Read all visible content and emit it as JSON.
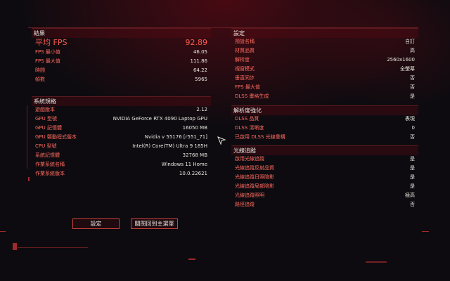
{
  "results": {
    "header": "結果",
    "avg_fps_label": "平均 FPS",
    "avg_fps_value": "92.89",
    "rows": [
      {
        "label": "FPS 最小值",
        "value": "46.05"
      },
      {
        "label": "FPS 最大值",
        "value": "111.86"
      },
      {
        "label": "時間",
        "value": "64.22"
      },
      {
        "label": "幀數",
        "value": "5965"
      }
    ]
  },
  "system": {
    "header": "系統規格",
    "rows": [
      {
        "label": "遊戲版本",
        "value": "2.12"
      },
      {
        "label": "GPU 型號",
        "value": "NVIDIA GeForce RTX 4090 Laptop GPU"
      },
      {
        "label": "GPU 記憶體",
        "value": "16050 MB"
      },
      {
        "label": "GPU 驅動程式版本",
        "value": "Nvidia v 55176 [r551_71]"
      },
      {
        "label": "CPU 型號",
        "value": "Intel(R) Core(TM) Ultra 9 185H"
      },
      {
        "label": "系統記憶體",
        "value": "32768 MB"
      },
      {
        "label": "作業系統名稱",
        "value": "Windows 11 Home"
      },
      {
        "label": "作業系統版本",
        "value": "10.0.22621"
      }
    ]
  },
  "settings": {
    "header": "設定",
    "rows": [
      {
        "label": "預設名稱",
        "value": "自訂"
      },
      {
        "label": "材質品質",
        "value": "高"
      },
      {
        "label": "解析度",
        "value": "2560x1600"
      },
      {
        "label": "視窗模式",
        "value": "全螢幕"
      },
      {
        "label": "垂直同步",
        "value": "否"
      },
      {
        "label": "FPS 最大值",
        "value": "否"
      },
      {
        "label": "DLSS 畫格生成",
        "value": "是"
      }
    ]
  },
  "resolution": {
    "header": "解析度強化",
    "rows": [
      {
        "label": "DLSS 品質",
        "value": "表現"
      },
      {
        "label": "DLSS 清晰度",
        "value": "0"
      },
      {
        "label": "已啟用 DLSS 光線重構",
        "value": "否"
      }
    ]
  },
  "raytracing": {
    "header": "光線追蹤",
    "rows": [
      {
        "label": "啟用光線追蹤",
        "value": "是"
      },
      {
        "label": "光線追蹤反射品質",
        "value": "是"
      },
      {
        "label": "光線追蹤日照陰影",
        "value": "是"
      },
      {
        "label": "光線追蹤局部陰影",
        "value": "是"
      },
      {
        "label": "光線追蹤照明",
        "value": "極高"
      },
      {
        "label": "路徑追蹤",
        "value": "否"
      }
    ]
  },
  "buttons": {
    "settings": "設定",
    "close": "關閉回到主選單"
  }
}
